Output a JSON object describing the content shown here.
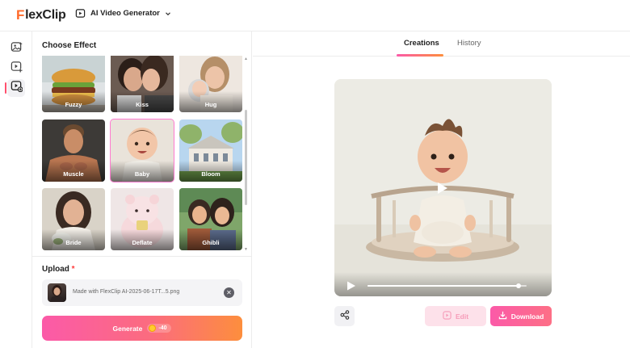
{
  "app": {
    "logo_prefix": "F",
    "logo_text": "lexClip",
    "tool_name": "AI Video Generator"
  },
  "rail": {
    "items": [
      {
        "icon": "ai-image-icon",
        "active": false
      },
      {
        "icon": "video-plus-icon",
        "active": false
      },
      {
        "icon": "ai-video-icon",
        "active": true
      }
    ]
  },
  "effects": {
    "title": "Choose Effect",
    "items": [
      {
        "label": "Fuzzy",
        "selected": false
      },
      {
        "label": "Kiss",
        "selected": false
      },
      {
        "label": "Hug",
        "selected": false
      },
      {
        "label": "Muscle",
        "selected": false
      },
      {
        "label": "Baby",
        "selected": true
      },
      {
        "label": "Bloom",
        "selected": false
      },
      {
        "label": "Bride",
        "selected": false
      },
      {
        "label": "Deflate",
        "selected": false
      },
      {
        "label": "Ghibli",
        "selected": false
      }
    ]
  },
  "upload": {
    "title": "Upload",
    "required_mark": "*",
    "file_name": "Made with FlexClip AI-2025-06-17T...5.png"
  },
  "generate": {
    "label": "Generate",
    "credits": "-40"
  },
  "tabs": {
    "creations": "Creations",
    "history": "History",
    "active": "creations"
  },
  "player": {
    "progress": 0.95
  },
  "actions": {
    "edit": "Edit",
    "download": "Download"
  },
  "colors": {
    "accent_pink": "#fb5aa8",
    "accent_orange": "#fd8e3d",
    "logo_orange": "#ff6a2a"
  }
}
